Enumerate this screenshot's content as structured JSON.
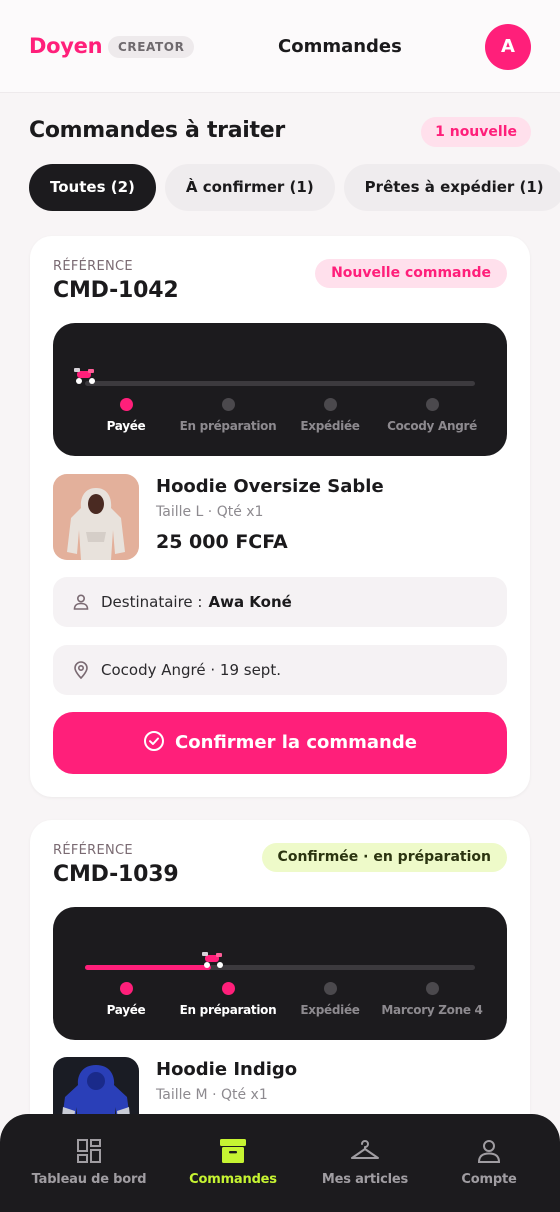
{
  "header": {
    "brand": "Doyen",
    "badge": "CREATOR",
    "title": "Commandes",
    "avatar_initial": "A"
  },
  "section": {
    "title": "Commandes à traiter",
    "new_badge": "1 nouvelle"
  },
  "tabs": [
    {
      "label": "Toutes (2)",
      "active": true
    },
    {
      "label": "À confirmer (1)",
      "active": false
    },
    {
      "label": "Prêtes à expédier (1)",
      "active": false
    }
  ],
  "orders": [
    {
      "ref_label": "RÉFÉRENCE",
      "ref": "CMD-1042",
      "status": "Nouvelle commande",
      "progress": 0,
      "steps": [
        "Payée",
        "En préparation",
        "Expédiée",
        "Cocody Angré"
      ],
      "completed_steps": 1,
      "product": {
        "name": "Hoodie Oversize Sable",
        "meta": "Taille L · Qté x1",
        "price": "25 000 FCFA"
      },
      "recipient_label": "Destinataire :",
      "recipient": "Awa Koné",
      "location": "Cocody Angré · 19 sept.",
      "action": "Confirmer la commande"
    },
    {
      "ref_label": "RÉFÉRENCE",
      "ref": "CMD-1039",
      "status": "Confirmée · en préparation",
      "progress": 0.33,
      "steps": [
        "Payée",
        "En préparation",
        "Expédiée",
        "Marcory Zone 4"
      ],
      "completed_steps": 2,
      "product": {
        "name": "Hoodie Indigo",
        "meta": "Taille M · Qté x1"
      }
    }
  ],
  "nav": [
    {
      "label": "Tableau de bord",
      "icon": "dashboard-icon",
      "active": false
    },
    {
      "label": "Commandes",
      "icon": "archive-box-icon",
      "active": true
    },
    {
      "label": "Mes articles",
      "icon": "hanger-icon",
      "active": false
    },
    {
      "label": "Compte",
      "icon": "user-icon",
      "active": false
    }
  ],
  "colors": {
    "accent": "#ff1f7a",
    "nav_active": "#c6f432",
    "dark": "#1c1b1e"
  }
}
